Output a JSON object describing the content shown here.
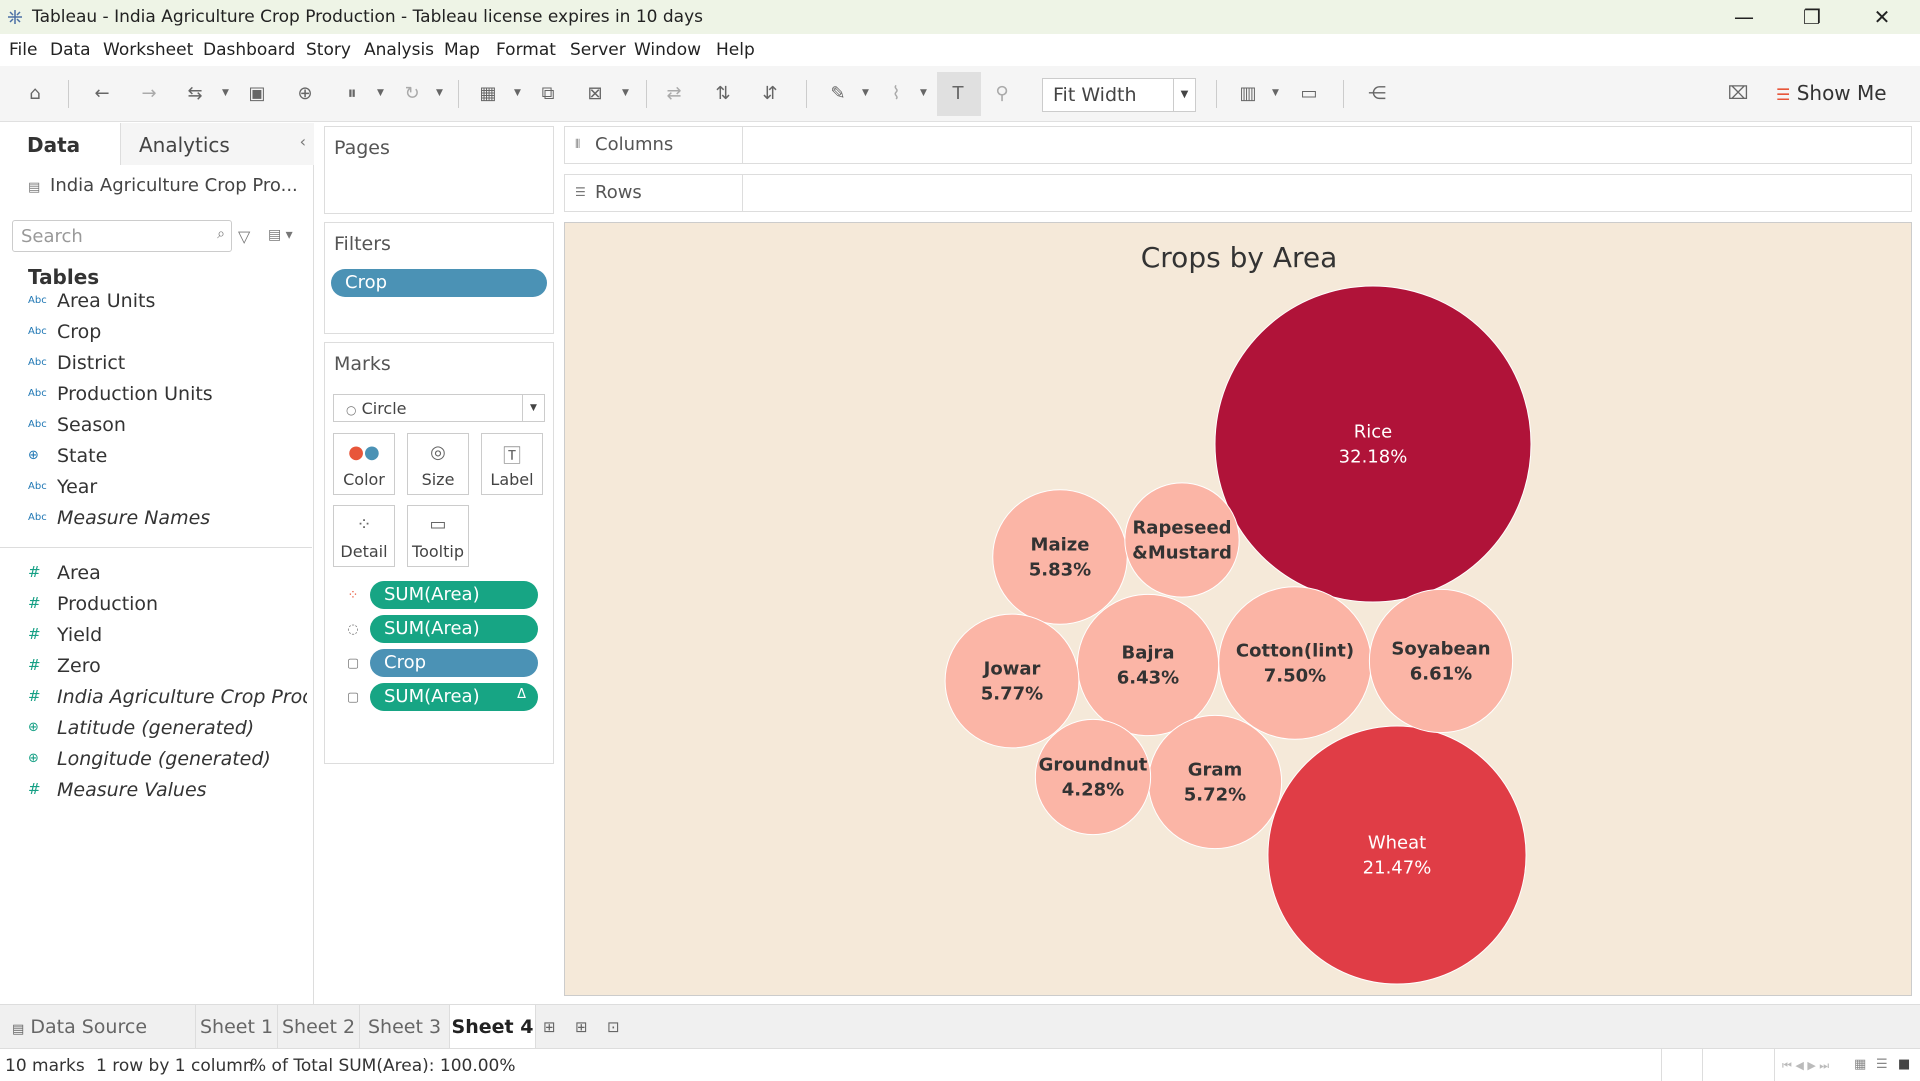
{
  "window": {
    "title": "Tableau - India Agriculture Crop Production - Tableau license expires in 10 days",
    "minimize": "—",
    "restore": "❐",
    "close": "✕"
  },
  "menu": [
    "File",
    "Data",
    "Worksheet",
    "Dashboard",
    "Story",
    "Analysis",
    "Map",
    "Format",
    "Server",
    "Window",
    "Help"
  ],
  "toolbar": {
    "fit": "Fit Width",
    "show_me": "Show Me"
  },
  "data_pane": {
    "tab_data": "Data",
    "tab_analytics": "Analytics",
    "collapse": "‹",
    "datasource": "India Agriculture Crop Pro...",
    "search_placeholder": "Search",
    "tables_heading": "Tables",
    "dimensions": [
      {
        "name": "Area Units",
        "type": "Abc"
      },
      {
        "name": "Crop",
        "type": "Abc"
      },
      {
        "name": "District",
        "type": "Abc"
      },
      {
        "name": "Production Units",
        "type": "Abc"
      },
      {
        "name": "Season",
        "type": "Abc"
      },
      {
        "name": "State",
        "type": "geo"
      },
      {
        "name": "Year",
        "type": "Abc"
      },
      {
        "name": "Measure Names",
        "type": "Abc"
      }
    ],
    "measures": [
      {
        "name": "Area"
      },
      {
        "name": "Production"
      },
      {
        "name": "Yield"
      },
      {
        "name": "Zero"
      },
      {
        "name": "India Agriculture Crop Prod..."
      },
      {
        "name": "Latitude (generated)"
      },
      {
        "name": "Longitude (generated)"
      },
      {
        "name": "Measure Values"
      }
    ]
  },
  "shelves": {
    "pages": "Pages",
    "filters": "Filters",
    "filter_pill": "Crop",
    "marks": "Marks",
    "mark_type": "Circle",
    "mark_buttons": [
      "Color",
      "Size",
      "Label",
      "Detail",
      "Tooltip"
    ],
    "mark_pills": [
      "SUM(Area)",
      "SUM(Area)",
      "Crop",
      "SUM(Area)"
    ],
    "delta": "Δ",
    "columns": "Columns",
    "rows": "Rows"
  },
  "colors": {
    "max": "#b01339",
    "high": "#e84448",
    "low": "#fbb5a6",
    "background": "#f5e9d9"
  },
  "chart_data": {
    "type": "packed-bubble",
    "title": "Crops by Area",
    "measure": "% of Total SUM(Area)",
    "items": [
      {
        "label": "Rice",
        "value_label": "32.18%",
        "value": 32.18
      },
      {
        "label": "Wheat",
        "value_label": "21.47%",
        "value": 21.47
      },
      {
        "label": "Cotton(lint)",
        "value_label": "7.50%",
        "value": 7.5
      },
      {
        "label": "Soyabean",
        "value_label": "6.61%",
        "value": 6.61
      },
      {
        "label": "Bajra",
        "value_label": "6.43%",
        "value": 6.43
      },
      {
        "label": "Maize",
        "value_label": "5.83%",
        "value": 5.83
      },
      {
        "label": "Jowar",
        "value_label": "5.77%",
        "value": 5.77
      },
      {
        "label": "Gram",
        "value_label": "5.72%",
        "value": 5.72
      },
      {
        "label": "Groundnut",
        "value_label": "4.28%",
        "value": 4.28
      },
      {
        "label": "Rapeseed\n&Mustard",
        "value_label": "",
        "value": 4.21
      }
    ]
  },
  "sheets": {
    "data_source": "Data Source",
    "tabs": [
      "Sheet 1",
      "Sheet 2",
      "Sheet 3",
      "Sheet 4"
    ],
    "active": "Sheet 4"
  },
  "status": {
    "marks": "10 marks",
    "dims": "1 row by 1 column",
    "summary": "% of Total SUM(Area): 100.00%"
  }
}
